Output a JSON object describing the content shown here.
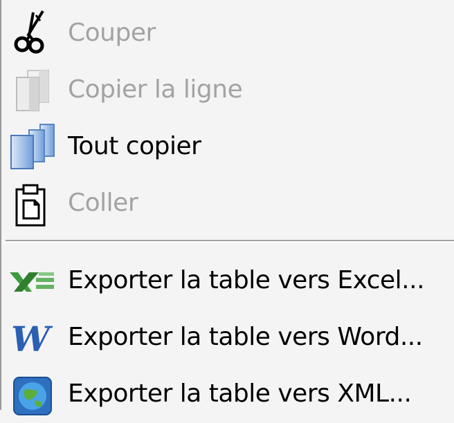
{
  "menu": {
    "items": [
      {
        "label": "Couper",
        "icon": "scissors-icon",
        "enabled": false
      },
      {
        "label": "Copier la ligne",
        "icon": "copy-line-icon",
        "enabled": false
      },
      {
        "label": "Tout copier",
        "icon": "copy-all-icon",
        "enabled": true
      },
      {
        "label": "Coller",
        "icon": "paste-icon",
        "enabled": false
      }
    ],
    "export_items": [
      {
        "label": "Exporter la table vers Excel...",
        "icon": "excel-icon",
        "enabled": true
      },
      {
        "label": "Exporter la table vers Word...",
        "icon": "word-icon",
        "enabled": true
      },
      {
        "label": "Exporter la table vers XML...",
        "icon": "xml-globe-icon",
        "enabled": true
      }
    ]
  }
}
